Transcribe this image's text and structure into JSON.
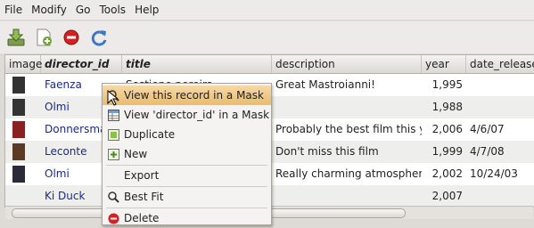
{
  "menubar": [
    "File",
    "Modify",
    "Go",
    "Tools",
    "Help"
  ],
  "toolbar": {
    "icons": [
      "download-icon",
      "new-document-icon",
      "stop-icon",
      "refresh-icon"
    ]
  },
  "columns": [
    "image",
    "director_id",
    "title",
    "description",
    "year",
    "date_release"
  ],
  "rows": [
    {
      "director": "Faenza",
      "title": "Sostiene pereira",
      "description": "Great Mastroianni!",
      "year": "1,995",
      "date": ""
    },
    {
      "director": "Olmi",
      "title": "",
      "description": "",
      "year": "1,988",
      "date": ""
    },
    {
      "director": "Donnersmak",
      "title": "",
      "description": "Probably the best film this y...",
      "year": "2,006",
      "date": "4/6/07"
    },
    {
      "director": "Leconte",
      "title": "",
      "description": "Don't miss this film",
      "year": "1,999",
      "date": "4/7/08"
    },
    {
      "director": "Olmi",
      "title": "",
      "description": "Really charming atmosphere...",
      "year": "2,002",
      "date": "10/24/03"
    },
    {
      "director": "Ki Duck",
      "title": "",
      "description": "",
      "year": "2,007",
      "date": ""
    }
  ],
  "context_menu": {
    "items": [
      {
        "label": "View this record in a Mask",
        "icon": "magnifier-icon"
      },
      {
        "label": "View 'director_id' in a Mask",
        "icon": "table-icon"
      },
      {
        "label": "Duplicate",
        "icon": "duplicate-icon"
      },
      {
        "label": "New",
        "icon": "new-record-icon"
      },
      {
        "label": "Export",
        "icon": ""
      },
      {
        "label": "Best Fit",
        "icon": "magnifier-icon"
      },
      {
        "label": "Delete",
        "icon": "delete-icon"
      }
    ]
  },
  "colors": {
    "accent": "#e9bb6e",
    "link": "#1b2a8a"
  }
}
